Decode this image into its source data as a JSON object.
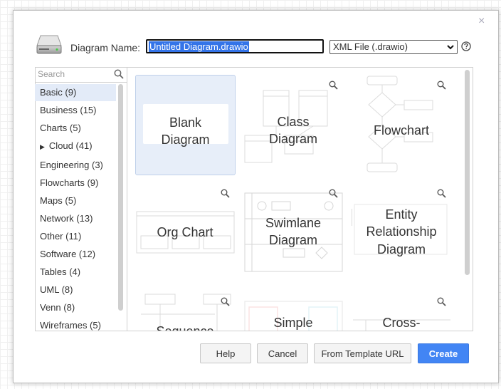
{
  "header": {
    "diagram_name_label": "Diagram Name:",
    "diagram_name_value": "Untitled Diagram.drawio",
    "format_value": "XML File (.drawio)",
    "close_glyph": "×"
  },
  "search": {
    "placeholder": "Search"
  },
  "categories": [
    {
      "label": "Basic (9)"
    },
    {
      "label": "Business (15)"
    },
    {
      "label": "Charts (5)"
    },
    {
      "label": "Cloud (41)"
    },
    {
      "label": "Engineering (3)"
    },
    {
      "label": "Flowcharts (9)"
    },
    {
      "label": "Maps (5)"
    },
    {
      "label": "Network (13)"
    },
    {
      "label": "Other (11)"
    },
    {
      "label": "Software (12)"
    },
    {
      "label": "Tables (4)"
    },
    {
      "label": "UML (8)"
    },
    {
      "label": "Venn (8)"
    },
    {
      "label": "Wireframes (5)"
    }
  ],
  "templates": [
    {
      "line1": "Blank",
      "line2": "Diagram"
    },
    {
      "line1": "Class",
      "line2": "Diagram"
    },
    {
      "line1": "Flowchart"
    },
    {
      "line1": "Org Chart"
    },
    {
      "line1": "Swimlane",
      "line2": "Diagram"
    },
    {
      "line1": "Entity",
      "line2": "Relationship",
      "line3": "Diagram"
    },
    {
      "line1": "Sequence"
    },
    {
      "line1": "Simple"
    },
    {
      "line1": "Cross-"
    }
  ],
  "buttons": {
    "help": "Help",
    "cancel": "Cancel",
    "from_template_url": "From Template URL",
    "create": "Create"
  },
  "colors": {
    "primary": "#4285f4",
    "selection": "#e7eef9"
  },
  "icons": [
    "drive-icon",
    "help-icon",
    "search-icon",
    "zoom-icon",
    "close-icon",
    "caret-right-icon",
    "chevron-down-icon"
  ]
}
